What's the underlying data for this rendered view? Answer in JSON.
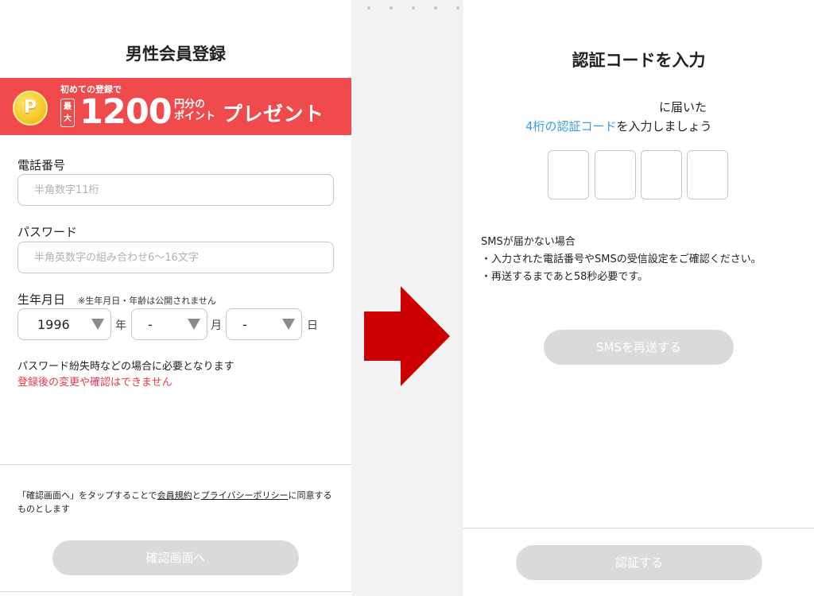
{
  "left": {
    "title": "男性会員登録",
    "banner": {
      "coin_letter": "P",
      "first_text": "初めての登録で",
      "max_text": "最大",
      "amount": "1200",
      "unit_line1": "円分の",
      "unit_line2": "ポイント",
      "present": "プレゼント"
    },
    "phone": {
      "label": "電話番号",
      "placeholder": "半角数字11桁"
    },
    "password": {
      "label": "パスワード",
      "placeholder": "半角英数字の組み合わせ6〜16文字"
    },
    "birthdate": {
      "label": "生年月日",
      "note": "※生年月日・年齢は公開されません",
      "year_value": "1996",
      "year_unit": "年",
      "month_value": "-",
      "month_unit": "月",
      "day_value": "-",
      "day_unit": "日"
    },
    "info_text": "パスワード紛失時などの場合に必要となります",
    "warn_text": "登録後の変更や確認はできません",
    "terms": {
      "part1": "「確認画面へ」をタップすることで",
      "link1": "会員規約",
      "part2": "と",
      "link2": "プライバシーポリシー",
      "part3": "に同意するものとします"
    },
    "confirm_button": "確認画面へ"
  },
  "right": {
    "title": "認証コードを入力",
    "line1": "に届いた",
    "line2_blue": "4桁の認証コード",
    "line2_rest": "を入力しましょう",
    "sms_heading": "SMSが届かない場合",
    "sms_item1": "・入力された電話番号やSMSの受信設定をご確認ください。",
    "sms_item2": "・再送するまであと58秒必要です。",
    "resend_button": "SMSを再送する",
    "verify_button": "認証する"
  },
  "colors": {
    "banner_red": "#ef4b4d",
    "arrow_red": "#cc0000",
    "link_blue": "#3aa0d8",
    "warn_red": "#e8394c",
    "disabled_button": "#dadada"
  }
}
